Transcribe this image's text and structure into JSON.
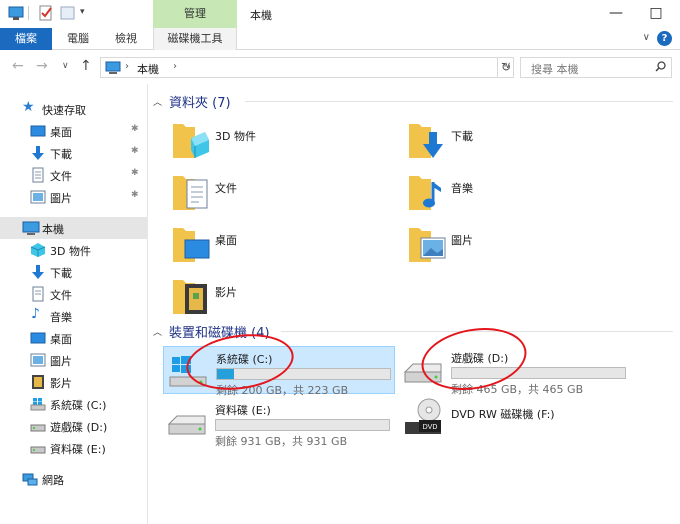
{
  "window": {
    "title": "本機",
    "manage_tab": "管理",
    "minimize": "—",
    "maximize": "□"
  },
  "ribbon": {
    "tabs": [
      "檔案",
      "電腦",
      "檢視"
    ],
    "contextual_tab": "磁碟機工具",
    "expand": "∨",
    "help": "?"
  },
  "address": {
    "back": "←",
    "forward": "→",
    "recent": "∨",
    "up": "↑",
    "path": "本機",
    "sep": "›",
    "dropdown": "∨",
    "refresh": "↻",
    "search_placeholder": "搜尋 本機",
    "pin": "✱"
  },
  "nav": {
    "quick_access": "快速存取",
    "quick_items": [
      "桌面",
      "下載",
      "文件",
      "圖片"
    ],
    "this_pc": "本機",
    "pc_items": [
      "3D 物件",
      "下載",
      "文件",
      "音樂",
      "桌面",
      "圖片",
      "影片",
      "系統碟 (C:)",
      "遊戲碟 (D:)",
      "資料碟 (E:)"
    ],
    "network": "網路"
  },
  "folders_group": {
    "header": "資料夾 (7)",
    "items": [
      "3D 物件",
      "下載",
      "文件",
      "音樂",
      "桌面",
      "圖片",
      "影片"
    ]
  },
  "drives_group": {
    "header": "裝置和磁碟機 (4)",
    "drives": [
      {
        "name": "系統碟 (C:)",
        "free": "剩餘 200 GB，共 223 GB",
        "used_fraction": 0.1
      },
      {
        "name": "遊戲碟 (D:)",
        "free": "剩餘 465 GB，共 465 GB",
        "used_fraction": 0.0
      },
      {
        "name": "資料碟 (E:)",
        "free": "剩餘 931 GB，共 931 GB",
        "used_fraction": 0.0
      },
      {
        "name": "DVD RW 磁碟機 (F:)"
      }
    ],
    "dvd_badge": "DVD"
  },
  "colors": {
    "accent": "#1a6bbf",
    "selection": "#cce8ff",
    "usage_bar": "#26a0da",
    "annotation": "#e3161c",
    "group_header": "#1e3287"
  }
}
